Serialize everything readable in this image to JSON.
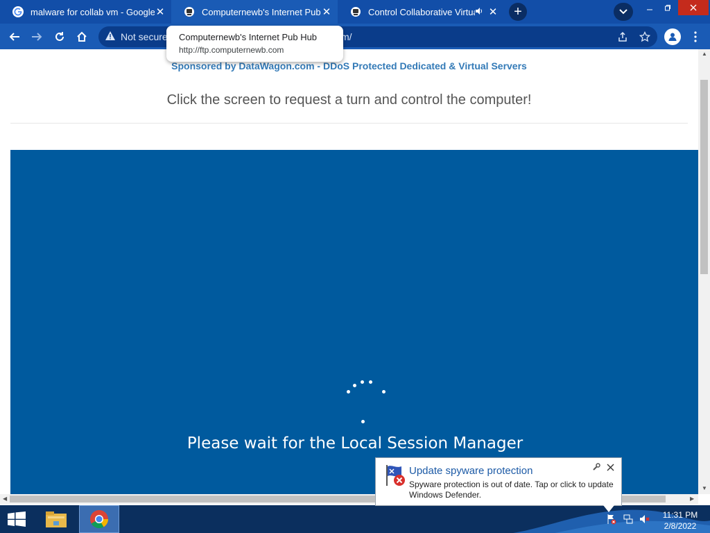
{
  "browser": {
    "tabs": [
      {
        "title": "malware for collab vm - Google S",
        "icon": "google-g-icon",
        "active": false
      },
      {
        "title": "Computernewb's Internet Pub Hu",
        "icon": "computernewb-icon",
        "active": true
      },
      {
        "title": "Control Collaborative Virtual",
        "icon": "computernewb-icon",
        "active": false,
        "audio": true
      }
    ],
    "close_glyph": "✕",
    "new_tab_glyph": "+",
    "omnibox": {
      "security_text": "Not secure",
      "url_suffix": "m/"
    },
    "tooltip": {
      "title": "Computernewb's Internet Pub Hub",
      "url": "http://ftp.computernewb.com"
    }
  },
  "page": {
    "sponsor_text": "Sponsored by DataWagon.com - DDoS Protected Dedicated & Virtual Servers",
    "headline": "Click the screen to request a turn and control the computer!",
    "vm_screen": {
      "status_text": "Please wait for the Local Session Manager",
      "background": "#005a9e"
    }
  },
  "notification": {
    "title": "Update spyware protection",
    "body": "Spyware protection is out of date. Tap or click to update Windows Defender."
  },
  "taskbar": {
    "apps": [
      "file-explorer-icon",
      "chrome-icon"
    ],
    "active_app": "chrome-icon",
    "time": "11:31 PM",
    "date": "2/8/2022"
  },
  "colors": {
    "chrome_frame": "#124ea8",
    "chrome_active_tab": "#1a5bb5",
    "sponsor_link": "#337ab7",
    "vm_background": "#005a9e",
    "taskbar": "#0b2f5e"
  }
}
